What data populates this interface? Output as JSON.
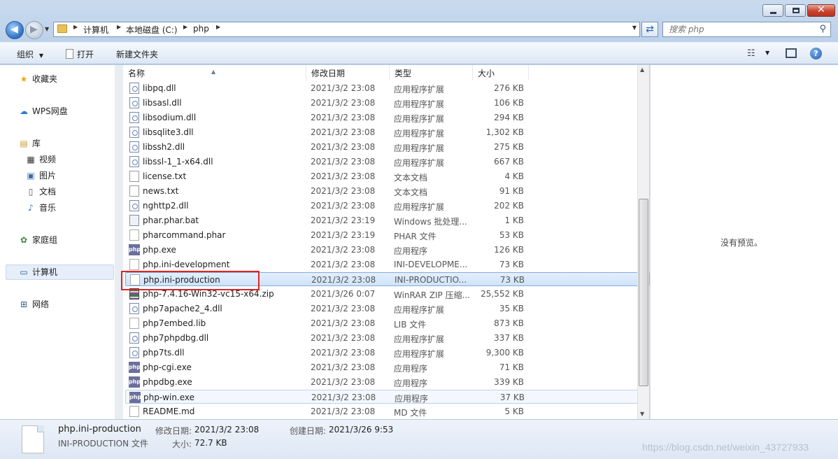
{
  "window": {
    "minimize_icon": "minimize-icon",
    "maximize_icon": "maximize-icon",
    "close_label": "✕"
  },
  "nav": {
    "back_icon": "arrow-left-icon",
    "forward_icon": "arrow-right-icon"
  },
  "address": {
    "crumbs": [
      "计算机",
      "本地磁盘 (C:)",
      "php"
    ]
  },
  "search": {
    "placeholder": "搜索 php"
  },
  "toolbar": {
    "organize": "组织",
    "open": "打开",
    "new_folder": "新建文件夹"
  },
  "sidebar": {
    "items": [
      {
        "label": "收藏夹",
        "icon": "star-icon"
      },
      {
        "label": "WPS网盘",
        "icon": "cloud-icon"
      },
      {
        "label": "库",
        "icon": "library-icon"
      },
      {
        "label": "视频",
        "icon": "video-icon"
      },
      {
        "label": "图片",
        "icon": "picture-icon"
      },
      {
        "label": "文档",
        "icon": "document-icon"
      },
      {
        "label": "音乐",
        "icon": "music-icon"
      },
      {
        "label": "家庭组",
        "icon": "homegroup-icon"
      },
      {
        "label": "计算机",
        "icon": "computer-icon"
      },
      {
        "label": "网络",
        "icon": "network-icon"
      }
    ]
  },
  "columns": {
    "name": "名称",
    "date": "修改日期",
    "type": "类型",
    "size": "大小"
  },
  "files": [
    {
      "name": "libpq.dll",
      "date": "2021/3/2 23:08",
      "type": "应用程序扩展",
      "size": "276 KB",
      "icon": "dll"
    },
    {
      "name": "libsasl.dll",
      "date": "2021/3/2 23:08",
      "type": "应用程序扩展",
      "size": "106 KB",
      "icon": "dll"
    },
    {
      "name": "libsodium.dll",
      "date": "2021/3/2 23:08",
      "type": "应用程序扩展",
      "size": "294 KB",
      "icon": "dll"
    },
    {
      "name": "libsqlite3.dll",
      "date": "2021/3/2 23:08",
      "type": "应用程序扩展",
      "size": "1,302 KB",
      "icon": "dll"
    },
    {
      "name": "libssh2.dll",
      "date": "2021/3/2 23:08",
      "type": "应用程序扩展",
      "size": "275 KB",
      "icon": "dll"
    },
    {
      "name": "libssl-1_1-x64.dll",
      "date": "2021/3/2 23:08",
      "type": "应用程序扩展",
      "size": "667 KB",
      "icon": "dll"
    },
    {
      "name": "license.txt",
      "date": "2021/3/2 23:08",
      "type": "文本文档",
      "size": "4 KB",
      "icon": "txt"
    },
    {
      "name": "news.txt",
      "date": "2021/3/2 23:08",
      "type": "文本文档",
      "size": "91 KB",
      "icon": "txt"
    },
    {
      "name": "nghttp2.dll",
      "date": "2021/3/2 23:08",
      "type": "应用程序扩展",
      "size": "202 KB",
      "icon": "dll"
    },
    {
      "name": "phar.phar.bat",
      "date": "2021/3/2 23:19",
      "type": "Windows 批处理...",
      "size": "1 KB",
      "icon": "bat"
    },
    {
      "name": "pharcommand.phar",
      "date": "2021/3/2 23:19",
      "type": "PHAR 文件",
      "size": "53 KB",
      "icon": "blank"
    },
    {
      "name": "php.exe",
      "date": "2021/3/2 23:08",
      "type": "应用程序",
      "size": "126 KB",
      "icon": "exe"
    },
    {
      "name": "php.ini-development",
      "date": "2021/3/2 23:08",
      "type": "INI-DEVELOPME...",
      "size": "73 KB",
      "icon": "blank"
    },
    {
      "name": "php.ini-production",
      "date": "2021/3/2 23:08",
      "type": "INI-PRODUCTIO...",
      "size": "73 KB",
      "icon": "blank",
      "state": "selected"
    },
    {
      "name": "php-7.4.16-Win32-vc15-x64.zip",
      "date": "2021/3/26 0:07",
      "type": "WinRAR ZIP 压缩...",
      "size": "25,552 KB",
      "icon": "zip"
    },
    {
      "name": "php7apache2_4.dll",
      "date": "2021/3/2 23:08",
      "type": "应用程序扩展",
      "size": "35 KB",
      "icon": "dll"
    },
    {
      "name": "php7embed.lib",
      "date": "2021/3/2 23:08",
      "type": "LIB 文件",
      "size": "873 KB",
      "icon": "blank"
    },
    {
      "name": "php7phpdbg.dll",
      "date": "2021/3/2 23:08",
      "type": "应用程序扩展",
      "size": "337 KB",
      "icon": "dll"
    },
    {
      "name": "php7ts.dll",
      "date": "2021/3/2 23:08",
      "type": "应用程序扩展",
      "size": "9,300 KB",
      "icon": "dll"
    },
    {
      "name": "php-cgi.exe",
      "date": "2021/3/2 23:08",
      "type": "应用程序",
      "size": "71 KB",
      "icon": "exe"
    },
    {
      "name": "phpdbg.exe",
      "date": "2021/3/2 23:08",
      "type": "应用程序",
      "size": "339 KB",
      "icon": "exe"
    },
    {
      "name": "php-win.exe",
      "date": "2021/3/2 23:08",
      "type": "应用程序",
      "size": "37 KB",
      "icon": "exe",
      "state": "hover"
    },
    {
      "name": "README.md",
      "date": "2021/3/2 23:08",
      "type": "MD 文件",
      "size": "5 KB",
      "icon": "blank"
    }
  ],
  "exe_icon_text": "php",
  "preview": {
    "empty_text": "没有预览。"
  },
  "details": {
    "filename": "php.ini-production",
    "filetype": "INI-PRODUCTION 文件",
    "modified_label": "修改日期:",
    "modified_value": "2021/3/2 23:08",
    "size_label": "大小:",
    "size_value": "72.7 KB",
    "created_label": "创建日期:",
    "created_value": "2021/3/26 9:53"
  },
  "watermark": "https://blog.csdn.net/weixin_43727933",
  "colors": {
    "selection_border": "#84acdd",
    "highlight_box": "#e02424"
  }
}
